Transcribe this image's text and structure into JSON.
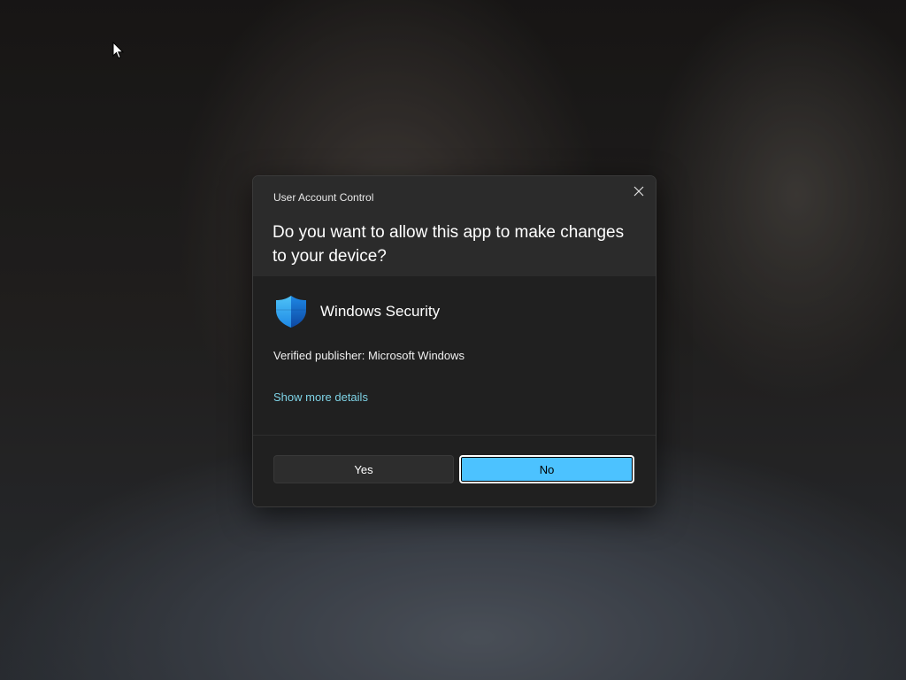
{
  "dialog": {
    "title": "User Account Control",
    "question": "Do you want to allow this app to make changes to your device?",
    "app_name": "Windows Security",
    "app_icon": "shield-icon",
    "publisher": "Verified publisher: Microsoft Windows",
    "details_link": "Show more details",
    "yes_label": "Yes",
    "no_label": "No",
    "close_icon": "close-icon"
  },
  "colors": {
    "dialog_background": "#202020",
    "header_background": "#2b2b2b",
    "link": "#7ed3e6",
    "accent_button": "#4cc2ff"
  }
}
